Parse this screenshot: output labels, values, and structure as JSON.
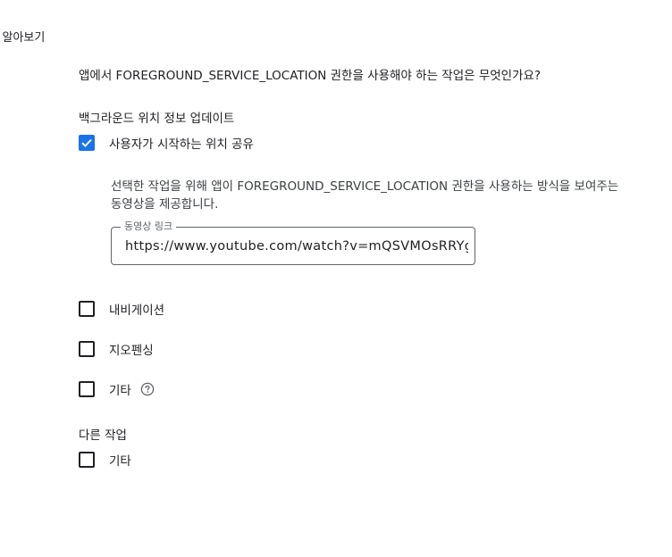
{
  "header": {
    "learn_more_link": "| 알아보기"
  },
  "question": "앱에서 FOREGROUND_SERVICE_LOCATION 권한을 사용해야 하는 작업은 무엇인가요?",
  "sections": {
    "background_location": {
      "title": "백그라운드 위치 정보 업데이트",
      "items": [
        {
          "label": "사용자가 시작하는 위치 공유",
          "checked": true
        }
      ],
      "description": "선택한 작업을 위해 앱이 FOREGROUND_SERVICE_LOCATION 권한을 사용하는 방식을 보여주는 동영상을 제공합니다.",
      "video_field": {
        "label": "동영상 링크",
        "value": "https://www.youtube.com/watch?v=mQSVMOsRRYg"
      }
    },
    "other_tasks_group": {
      "items": [
        {
          "label": "내비게이션",
          "checked": false
        },
        {
          "label": "지오펜싱",
          "checked": false
        },
        {
          "label": "기타",
          "checked": false
        }
      ]
    },
    "other_tasks": {
      "title": "다른 작업",
      "items": [
        {
          "label": "기타",
          "checked": false
        }
      ]
    }
  },
  "icons": {
    "checkmark": "check-icon",
    "help": "help-circle-icon"
  },
  "colors": {
    "accent": "#1a73e8",
    "text": "#202124",
    "muted": "#5f6368"
  }
}
